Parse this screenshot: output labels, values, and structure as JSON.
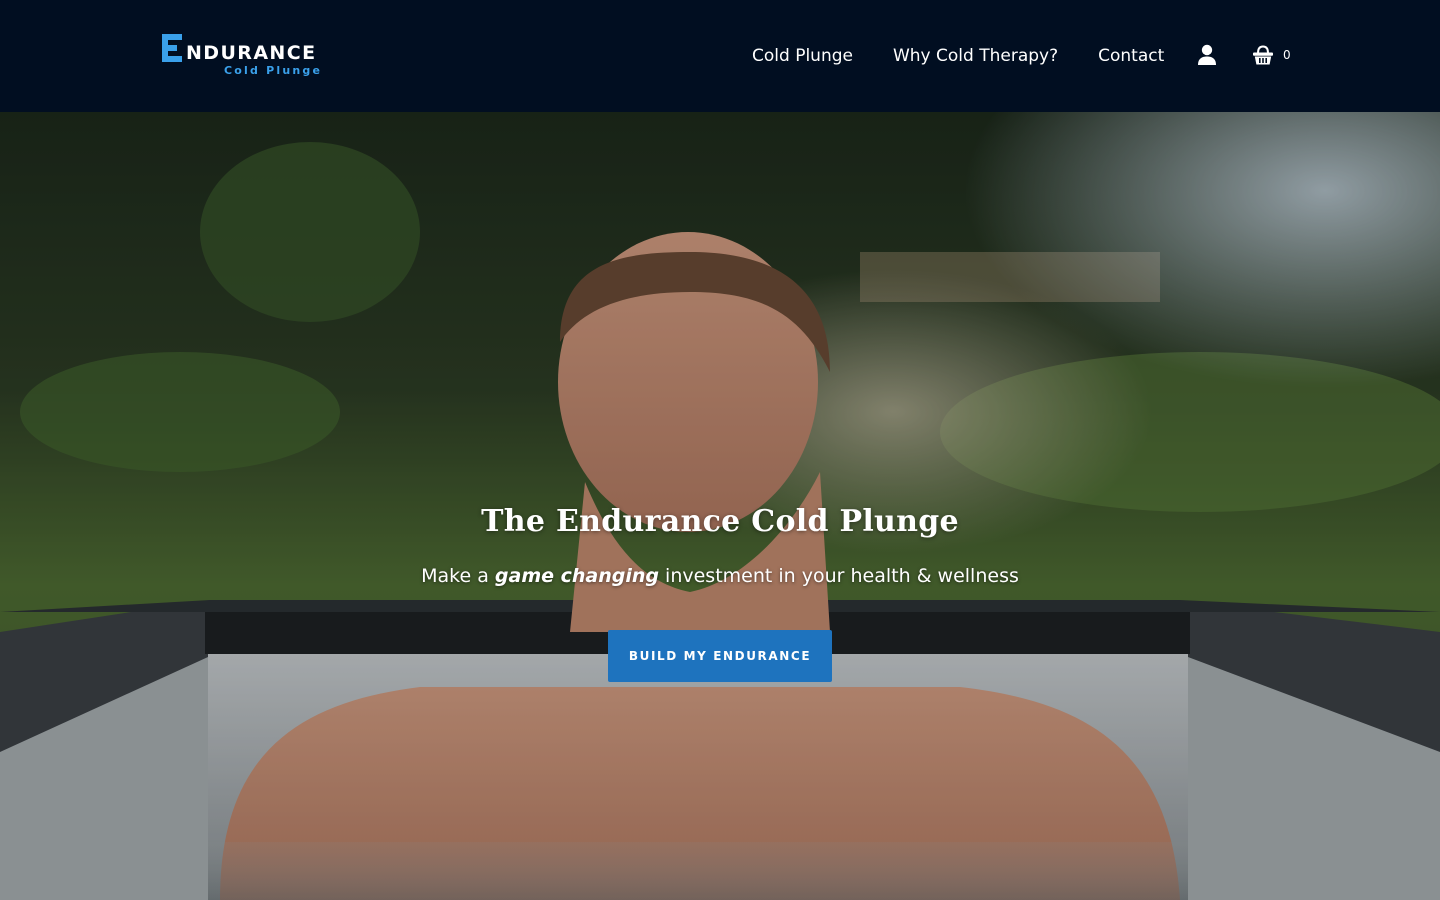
{
  "header": {
    "logo": {
      "letter": "E",
      "word": "NDURANCE",
      "sub": "Cold Plunge"
    },
    "nav": {
      "items": [
        "Cold Plunge",
        "Why Cold Therapy?",
        "Contact"
      ]
    },
    "account_icon": "user-icon",
    "cart": {
      "icon": "basket-icon",
      "count": "0"
    }
  },
  "hero": {
    "title": "The Endurance Cold Plunge",
    "subtitle_before": "Make a ",
    "subtitle_emphasis": "game changing",
    "subtitle_after": " investment in your health & wellness",
    "cta_label": "BUILD MY ENDURANCE"
  },
  "colors": {
    "header_bg": "#010e21",
    "accent_blue": "#3aa0ea",
    "button_blue": "#1e73be",
    "text": "#ffffff"
  }
}
